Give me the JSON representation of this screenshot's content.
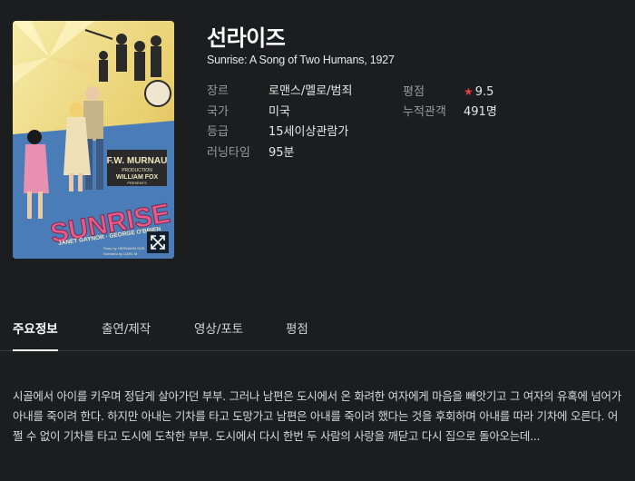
{
  "movie": {
    "title": "선라이즈",
    "original_title": "Sunrise: A Song of Two Humans, 1927"
  },
  "poster": {
    "image_text": {
      "director": "F.W. MURNAU",
      "production": "PRODUCTION",
      "presenter": "WILLIAM FOX",
      "presents": "PRESENTS",
      "headline": "SUNRISE",
      "cast": "JANET GAYNOR · GEORGE O'BRIEN",
      "credit_story": "Story by HERMANN SUD",
      "credit_scenario": "Scenario by CARL M"
    },
    "expand_icon": "expand-arrows-icon"
  },
  "info": {
    "genre_label": "장르",
    "genre": "로맨스/멜로/범죄",
    "country_label": "국가",
    "country": "미국",
    "rating_label": "등급",
    "rating": "15세이상관람가",
    "runtime_label": "러닝타임",
    "runtime": "95분",
    "score_label": "평점",
    "score": "9.5",
    "audience_label": "누적관객",
    "audience": "491명"
  },
  "tabs": [
    {
      "label": "주요정보",
      "active": true
    },
    {
      "label": "출연/제작",
      "active": false
    },
    {
      "label": "영상/포토",
      "active": false
    },
    {
      "label": "평점",
      "active": false
    }
  ],
  "synopsis": "시골에서 아이를 키우며 정답게 살아가던 부부. 그러나 남편은 도시에서 온 화려한 여자에게 마음을 빼앗기고 그 여자의 유혹에 넘어가 아내를 죽이려 한다. 하지만 아내는 기차를 타고 도망가고 남편은 아내를 죽이려 했다는 것을 후회하며 아내를 따라 기차에 오른다. 어쩔 수 없이 기차를 타고 도시에 도착한 부부. 도시에서 다시 한번 두 사람의 사랑을 깨닫고 다시 집으로 돌아오는데...",
  "colors": {
    "background": "#1c1d1f",
    "star": "#e8394a",
    "poster_sunrise_text": "#e85a8a"
  }
}
